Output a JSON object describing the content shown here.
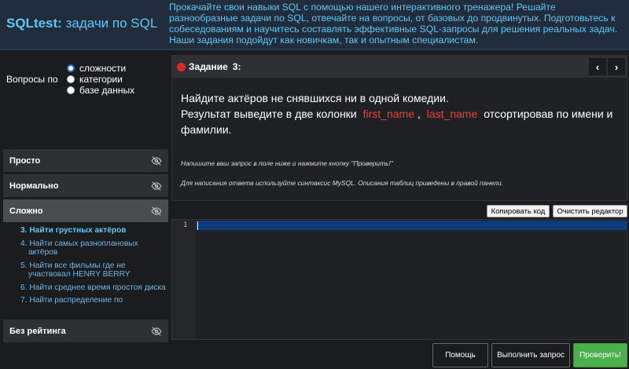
{
  "header": {
    "brand": "SQLtest:",
    "subtitle": "задачи по SQL",
    "intro": "Прокачайте свои навыки SQL с помощью нашего интерактивного тренажера! Решайте разнообразные задачи по SQL, отвечайте на вопросы, от базовых до продвинутых. Подготовьтесь к собеседованиям и научитесь составлять эффективные SQL-запросы для решения реальных задач. Наши задания подойдут как новичкам, так и опытным специалистам."
  },
  "filter": {
    "label": "Вопросы по",
    "options": [
      {
        "label": "сложности",
        "checked": true
      },
      {
        "label": "категории",
        "checked": false
      },
      {
        "label": "базе данных",
        "checked": false
      }
    ]
  },
  "sections": {
    "easy": "Просто",
    "normal": "Нормально",
    "hard": "Сложно",
    "unrated": "Без рейтинга"
  },
  "tasks": [
    "3. Найти грустных актёров",
    "4. Найти самых разноплановых актёров",
    "5. Найти все фильмы где не участвовал HENRY BERRY",
    "6. Найти среднее время простоя диска",
    "7. Найти распределение по"
  ],
  "task": {
    "title": "Задание",
    "number": "3:",
    "line1": "Найдите актёров не снявшихся ни в одной комедии.",
    "line2_prefix": "Результат выведите в две колонки",
    "col1": "first_name",
    "sep": ",",
    "col2": "last_name",
    "line2_suffix": "отсортировав по имени и фамилии.",
    "hint1": "Напишите ваш запрос в поле ниже и нажмите кнопку \"Проверить!\"",
    "hint2": "Для написания ответа используйте синтаксис MySQL. Описания таблиц приведены в правой панели.",
    "prev_icon": "‹",
    "next_icon": "›"
  },
  "editor": {
    "copy": "Копировать код",
    "clear": "Очистить редактор",
    "line_number": "1"
  },
  "buttons": {
    "help": "Помощь",
    "run": "Выполнить запрос",
    "check": "Проверить!"
  },
  "colors": {
    "accent": "#5ec8f5",
    "danger": "#e0262a",
    "success": "#4ab04a"
  }
}
